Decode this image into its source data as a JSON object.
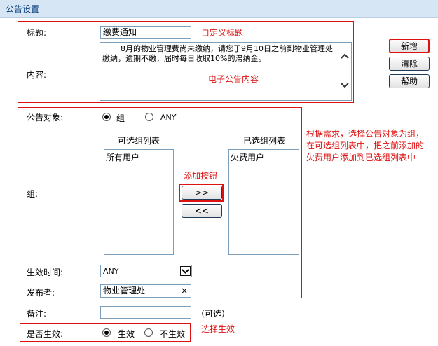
{
  "header": {
    "title": "公告设置"
  },
  "form": {
    "title_label": "标题:",
    "title_value": "缴费通知",
    "title_note": "自定义标题",
    "content_label": "内容:",
    "content_text": "8月的物业管理费尚未缴纳，请您于9月10日之前到物业管理处缴纳，逾期不缴，届时每日收取10%的滞纳金。",
    "content_note": "电子公告内容",
    "target_label": "公告对象:",
    "target_option_group": "组",
    "target_option_any": "ANY",
    "target_selected": "组",
    "available_list_title": "可选组列表",
    "available_items": [
      "所有用户"
    ],
    "selected_list_title": "已选组列表",
    "selected_items": [
      "欠费用户"
    ],
    "add_button_note": "添加按钮",
    "add_button_label": ">>",
    "remove_button_label": "<<",
    "group_label": "组:",
    "target_note": "根据需求，选择公告对象为组，在可选组列表中，把之前添加的欠费用户添加到已选组列表中",
    "effective_time_label": "生效时间:",
    "effective_time_value": "ANY",
    "publisher_label": "发布者:",
    "publisher_value": "物业管理处",
    "remark_label": "备注:",
    "remark_value": "",
    "remark_optional": "（可选）",
    "enable_label": "是否生效:",
    "enable_on": "生效",
    "enable_off": "不生效",
    "enable_selected": "生效",
    "enable_note": "选择生效"
  },
  "buttons": {
    "new": "新增",
    "clear": "清除",
    "help": "帮助"
  },
  "colors": {
    "annotation_red": "#dd1111",
    "header_bg": "#d7e6f5",
    "header_text": "#0b3f7a"
  }
}
